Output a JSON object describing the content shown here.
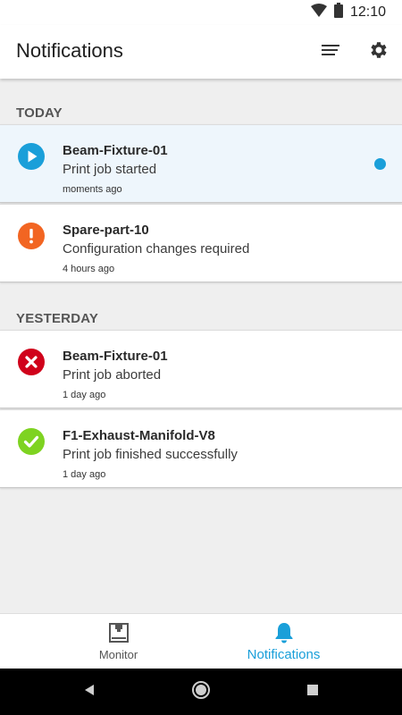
{
  "status_bar": {
    "time": "12:10"
  },
  "app_bar": {
    "title": "Notifications",
    "actions": [
      "filter-icon",
      "gear-icon"
    ]
  },
  "sections": [
    {
      "header": "TODAY",
      "items": [
        {
          "title": "Beam-Fixture-01",
          "message": "Print job started",
          "time": "moments ago",
          "status": "printing",
          "status_icon": "play-icon",
          "color": "#1a9fd9",
          "unread": true
        },
        {
          "title": "Spare-part-10",
          "message": "Configuration changes required",
          "time": "4 hours ago",
          "status": "warning",
          "status_icon": "exclamation-icon",
          "color": "#f26522",
          "unread": false
        }
      ]
    },
    {
      "header": "YESTERDAY",
      "items": [
        {
          "title": "Beam-Fixture-01",
          "message": "Print job aborted",
          "time": "1 day ago",
          "status": "error",
          "status_icon": "x-icon",
          "color": "#d0021b",
          "unread": false
        },
        {
          "title": "F1-Exhaust-Manifold-V8",
          "message": "Print job finished successfully",
          "time": "1 day ago",
          "status": "success",
          "status_icon": "check-icon",
          "color": "#7ed321",
          "unread": false
        }
      ]
    }
  ],
  "bottom_nav": {
    "items": [
      {
        "label": "Monitor",
        "icon": "printer-icon",
        "active": false
      },
      {
        "label": "Notifications",
        "icon": "bell-icon",
        "active": true
      }
    ]
  },
  "colors": {
    "accent": "#1a9fd9",
    "unread_background": "#eef6fc"
  }
}
